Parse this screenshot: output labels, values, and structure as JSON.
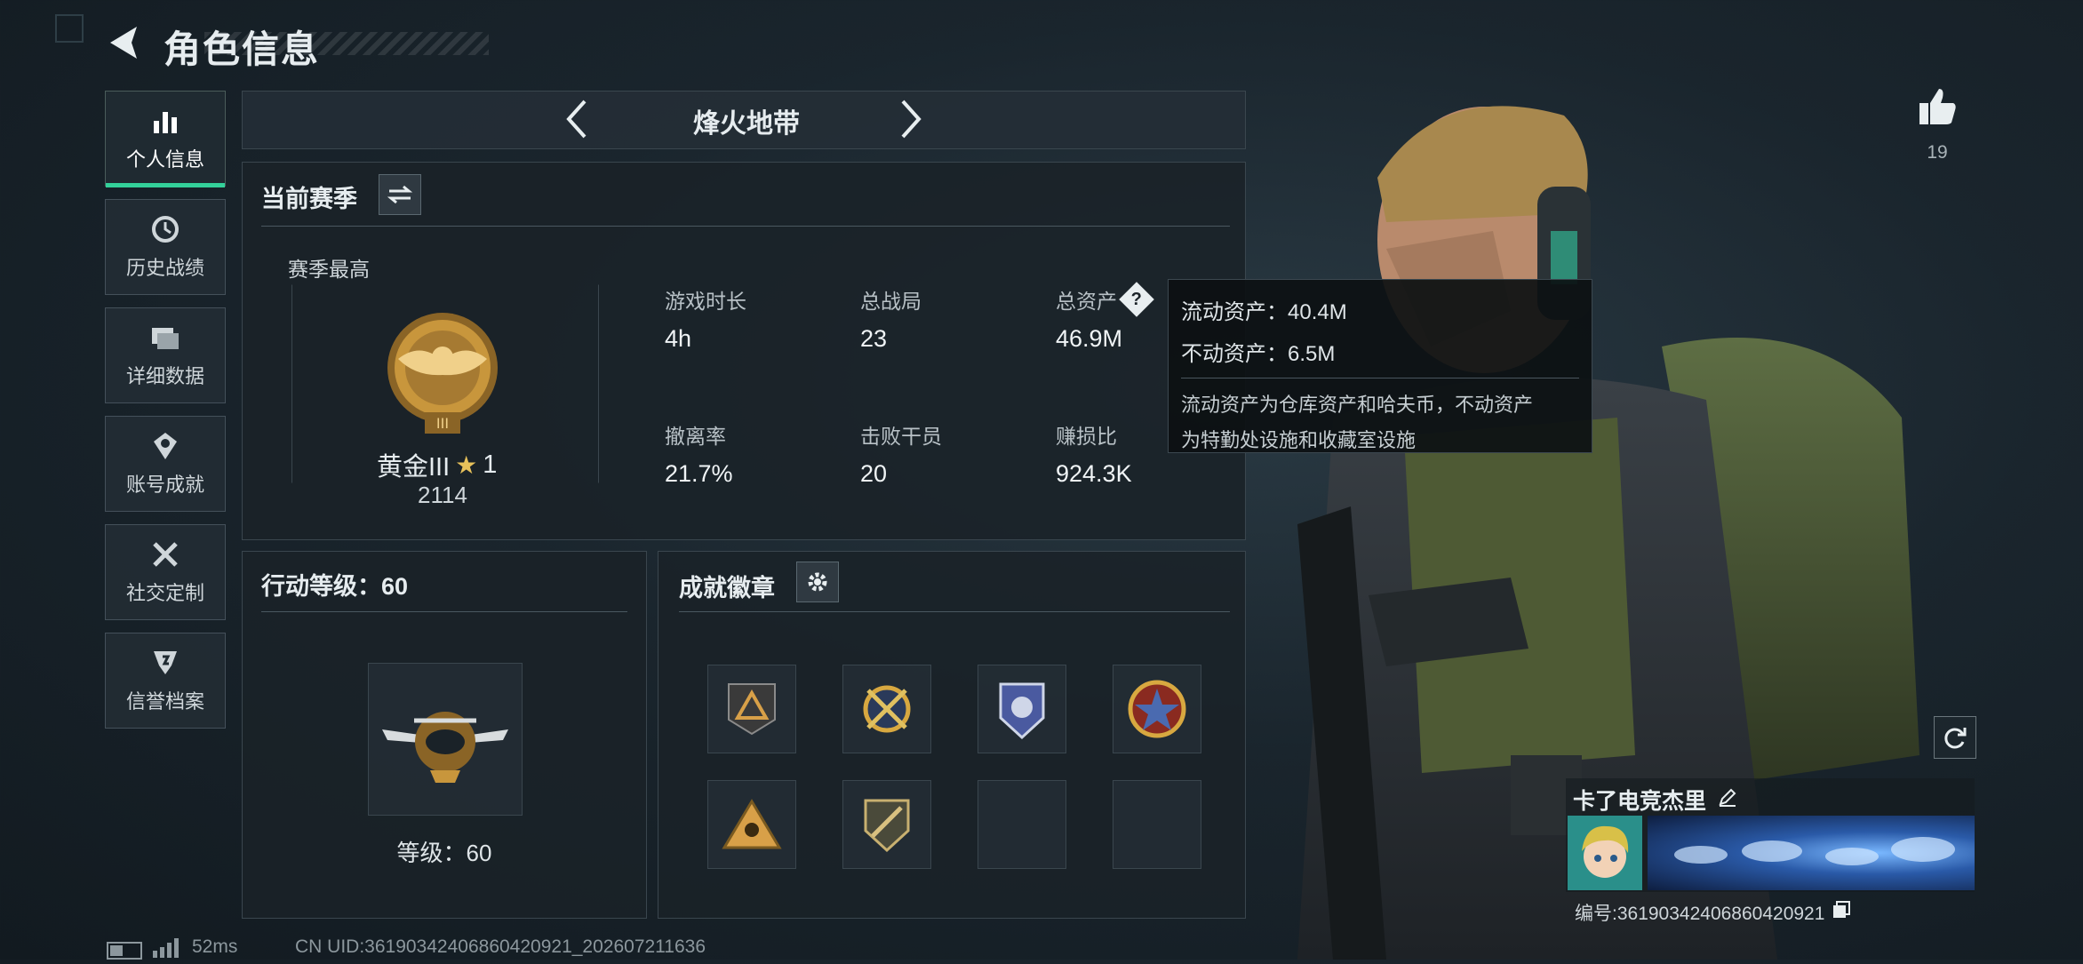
{
  "header": {
    "title": "角色信息"
  },
  "sidebar": {
    "items": [
      {
        "label": "个人信息",
        "icon": "bar-chart-icon"
      },
      {
        "label": "历史战绩",
        "icon": "history-icon"
      },
      {
        "label": "详细数据",
        "icon": "folder-icon"
      },
      {
        "label": "账号成就",
        "icon": "achievement-icon"
      },
      {
        "label": "社交定制",
        "icon": "tools-icon"
      },
      {
        "label": "信誉档案",
        "icon": "shield-icon"
      }
    ]
  },
  "mode_nav": {
    "label": "烽火地带"
  },
  "season": {
    "title": "当前赛季",
    "best_label": "赛季最高",
    "rank_name": "黄金III",
    "rank_stars": "1",
    "rank_score": "2114",
    "stats": [
      {
        "label": "游戏时长",
        "value": "4h"
      },
      {
        "label": "总战局",
        "value": "23"
      },
      {
        "label": "总资产",
        "value": "46.9M"
      },
      {
        "label": "撤离率",
        "value": "21.7%"
      },
      {
        "label": "击败干员",
        "value": "20"
      },
      {
        "label": "赚损比",
        "value": "924.3K"
      }
    ]
  },
  "tooltip": {
    "line1": "流动资产：40.4M",
    "line2": "不动资产：6.5M",
    "note1": "流动资产为仓库资产和哈夫币，不动资产",
    "note2": "为特勤处设施和收藏室设施"
  },
  "action_level": {
    "title": "行动等级：60",
    "level_label": "等级：60"
  },
  "badges": {
    "title": "成就徽章"
  },
  "likes": {
    "count": "19"
  },
  "player": {
    "name": "卡了电竞杰里",
    "id_text": "编号:3619034240686042092​1"
  },
  "footer": {
    "ping": "52ms",
    "uid": "CN UID:36190342406860420921_202607211636"
  },
  "colors": {
    "accent": "#33d19a",
    "gold": "#c8963c"
  }
}
